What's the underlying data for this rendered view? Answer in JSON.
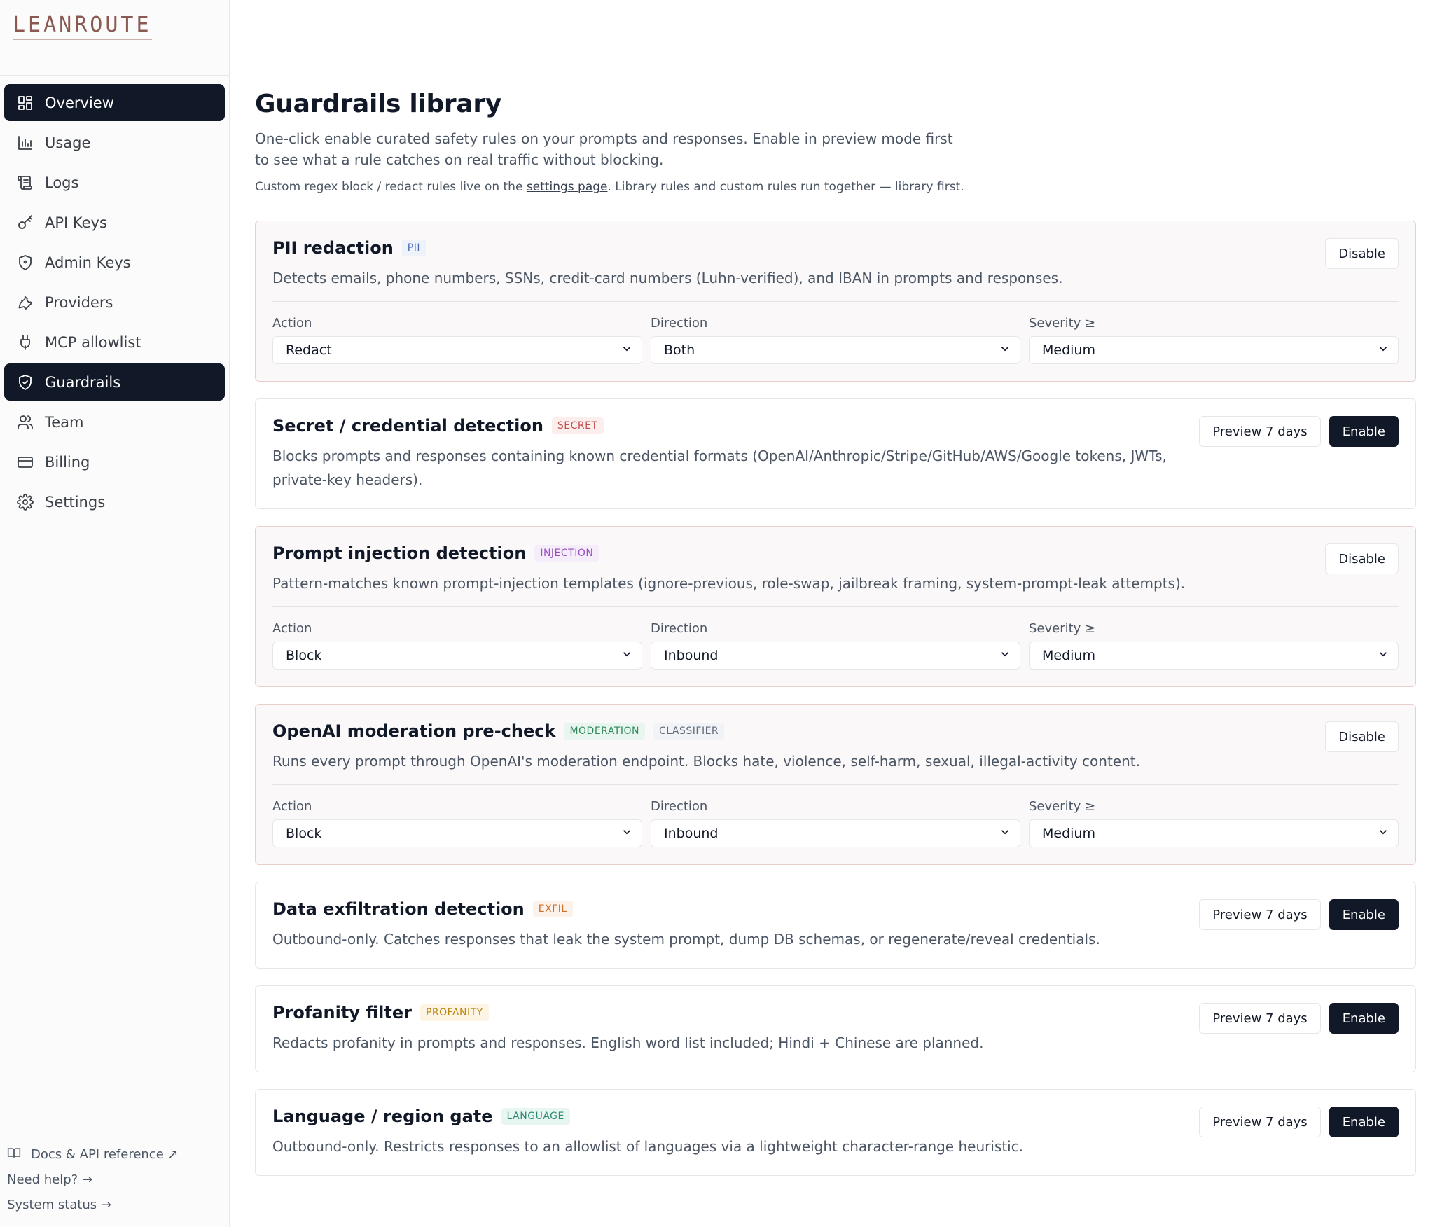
{
  "brand": {
    "logo_text": "LEANROUTE"
  },
  "sidebar": {
    "items": [
      {
        "label": "Overview",
        "icon": "layout-grid-icon"
      },
      {
        "label": "Usage",
        "icon": "bar-chart-icon"
      },
      {
        "label": "Logs",
        "icon": "scroll-icon"
      },
      {
        "label": "API Keys",
        "icon": "key-icon"
      },
      {
        "label": "Admin Keys",
        "icon": "shield-icon"
      },
      {
        "label": "Providers",
        "icon": "wrench-icon"
      },
      {
        "label": "MCP allowlist",
        "icon": "plug-icon"
      },
      {
        "label": "Guardrails",
        "icon": "shield-check-icon"
      },
      {
        "label": "Team",
        "icon": "users-icon"
      },
      {
        "label": "Billing",
        "icon": "credit-card-icon"
      },
      {
        "label": "Settings",
        "icon": "gear-icon"
      }
    ],
    "footer": {
      "docs": "Docs & API reference ↗",
      "help": "Need help? →",
      "status": "System status →"
    }
  },
  "page": {
    "title": "Guardrails library",
    "subtitle": "One-click enable curated safety rules on your prompts and responses. Enable in preview mode first to see what a rule catches on real traffic without blocking.",
    "note_prefix": "Custom regex block / redact rules live on the ",
    "note_link": "settings page",
    "note_suffix": ". Library rules and custom rules run together — library first."
  },
  "labels": {
    "action": "Action",
    "direction": "Direction",
    "severity": "Severity ≥",
    "disable": "Disable",
    "preview": "Preview 7 days",
    "enable": "Enable"
  },
  "rules": [
    {
      "title": "PII redaction",
      "badges": [
        {
          "text": "PII",
          "bg": "#eef2fb",
          "fg": "#4b6cb7"
        }
      ],
      "desc": "Detects emails, phone numbers, SSNs, credit-card numbers (Luhn-verified), and IBAN in prompts and responses.",
      "enabled": true,
      "action": "Redact",
      "direction": "Both",
      "severity": "Medium"
    },
    {
      "title": "Secret / credential detection",
      "badges": [
        {
          "text": "SECRET",
          "bg": "#fdeeee",
          "fg": "#c0504d"
        }
      ],
      "desc": "Blocks prompts and responses containing known credential formats (OpenAI/Anthropic/Stripe/GitHub/AWS/Google tokens, JWTs, private-key headers).",
      "enabled": false
    },
    {
      "title": "Prompt injection detection",
      "badges": [
        {
          "text": "INJECTION",
          "bg": "#f6edfb",
          "fg": "#9b4dbf"
        }
      ],
      "desc": "Pattern-matches known prompt-injection templates (ignore-previous, role-swap, jailbreak framing, system-prompt-leak attempts).",
      "enabled": true,
      "action": "Block",
      "direction": "Inbound",
      "severity": "Medium"
    },
    {
      "title": "OpenAI moderation pre-check",
      "badges": [
        {
          "text": "MODERATION",
          "bg": "#e9f6ef",
          "fg": "#2f8a5b"
        },
        {
          "text": "CLASSIFIER",
          "bg": "#f1f3f6",
          "fg": "#5f6b7a"
        }
      ],
      "desc": "Runs every prompt through OpenAI's moderation endpoint. Blocks hate, violence, self-harm, sexual, illegal-activity content.",
      "enabled": true,
      "action": "Block",
      "direction": "Inbound",
      "severity": "Medium"
    },
    {
      "title": "Data exfiltration detection",
      "badges": [
        {
          "text": "EXFIL",
          "bg": "#fdf2e9",
          "fg": "#c4702e"
        }
      ],
      "desc": "Outbound-only. Catches responses that leak the system prompt, dump DB schemas, or regenerate/reveal credentials.",
      "enabled": false
    },
    {
      "title": "Profanity filter",
      "badges": [
        {
          "text": "PROFANITY",
          "bg": "#fdf4e3",
          "fg": "#b8860b"
        }
      ],
      "desc": "Redacts profanity in prompts and responses. English word list included; Hindi + Chinese are planned.",
      "enabled": false
    },
    {
      "title": "Language / region gate",
      "badges": [
        {
          "text": "LANGUAGE",
          "bg": "#e8f6f2",
          "fg": "#2f8a74"
        }
      ],
      "desc": "Outbound-only. Restricts responses to an allowlist of languages via a lightweight character-range heuristic.",
      "enabled": false
    }
  ]
}
